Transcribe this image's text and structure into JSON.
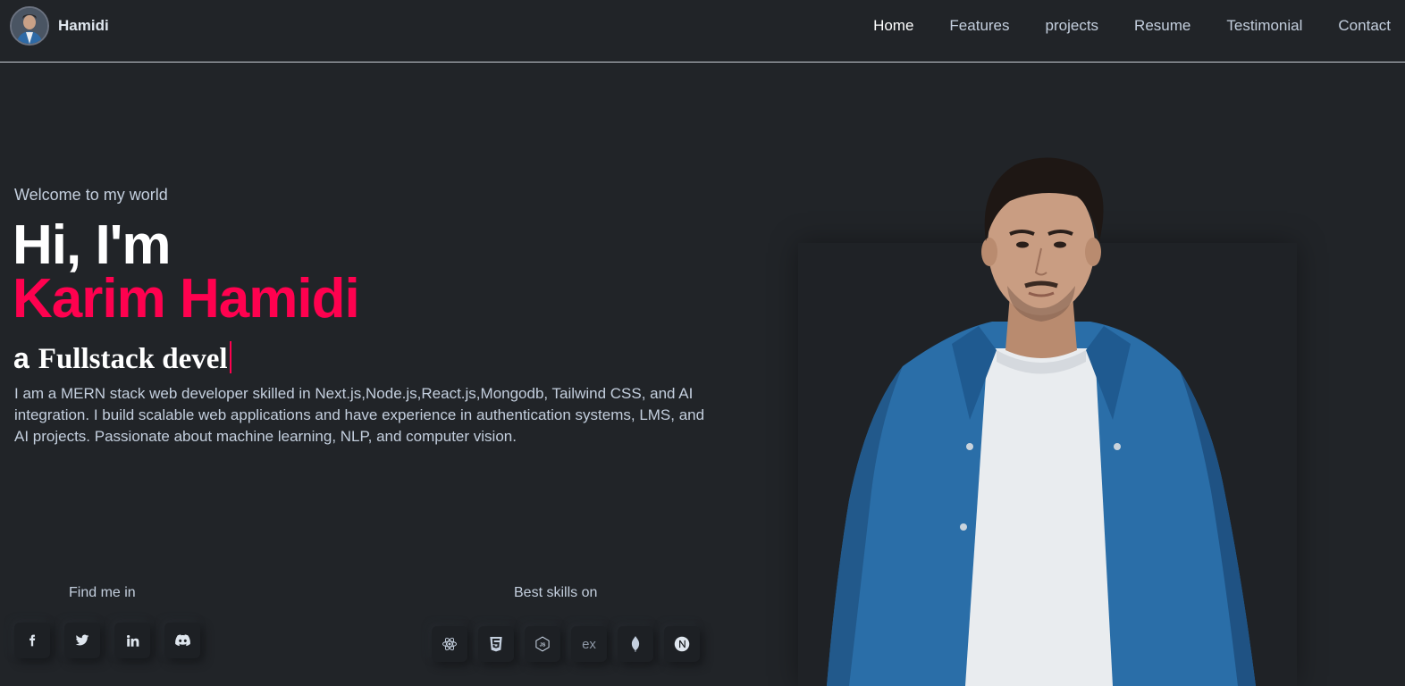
{
  "header": {
    "brand_name": "Hamidi",
    "nav": [
      "Home",
      "Features",
      "projects",
      "Resume",
      "Testimonial",
      "Contact"
    ]
  },
  "hero": {
    "welcome": "Welcome to my world",
    "greeting": "Hi, I'm",
    "name": "Karim Hamidi",
    "role_prefix": "a",
    "role_typed": "Fullstack devel",
    "description": "I am a MERN stack web developer skilled in Next.js,Node.js,React.js,Mongodb, Tailwind CSS, and AI integration. I build scalable web applications and have experience in authentication systems, LMS, and AI projects. Passionate about machine learning, NLP, and computer vision."
  },
  "social": {
    "title": "Find me in",
    "icons": [
      "facebook-icon",
      "twitter-icon",
      "linkedin-icon",
      "discord-icon"
    ]
  },
  "skills": {
    "title": "Best skills on",
    "icons": [
      "react-icon",
      "css3-icon",
      "nodejs-icon",
      "express-icon",
      "mongodb-icon",
      "nextjs-icon"
    ],
    "express_label": "ex"
  },
  "colors": {
    "background": "#212428",
    "accent": "#ff014f",
    "text": "#c4cfde",
    "heading": "#ffffff"
  }
}
